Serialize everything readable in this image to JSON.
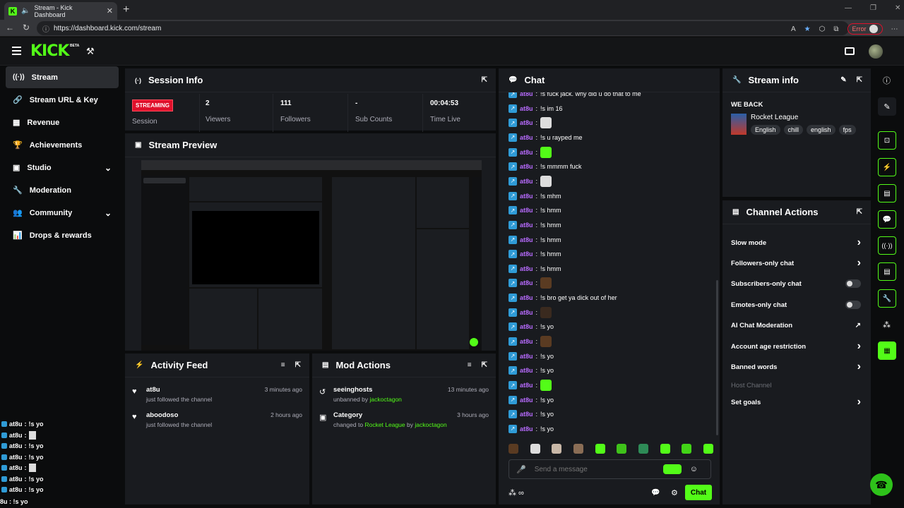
{
  "browser": {
    "tab_title": "Stream - Kick Dashboard",
    "url": "https://dashboard.kick.com/stream",
    "error_label": "Error"
  },
  "app": {
    "logo": "KICK",
    "logo_badge": "BETA"
  },
  "sidebar": {
    "items": [
      {
        "label": "Stream",
        "icon": "broadcast-icon"
      },
      {
        "label": "Stream URL & Key",
        "icon": "link-icon"
      },
      {
        "label": "Revenue",
        "icon": "revenue-icon"
      },
      {
        "label": "Achievements",
        "icon": "trophy-icon"
      },
      {
        "label": "Studio",
        "icon": "studio-icon"
      },
      {
        "label": "Moderation",
        "icon": "wrench-icon"
      },
      {
        "label": "Community",
        "icon": "community-icon"
      },
      {
        "label": "Drops & rewards",
        "icon": "drops-icon"
      }
    ]
  },
  "session": {
    "title": "Session Info",
    "status": "STREAMING",
    "stats": [
      {
        "value": "",
        "label": "Session"
      },
      {
        "value": "2",
        "label": "Viewers"
      },
      {
        "value": "111",
        "label": "Followers"
      },
      {
        "value": "-",
        "label": "Sub Counts"
      },
      {
        "value": "00:04:53",
        "label": "Time Live"
      }
    ]
  },
  "preview": {
    "title": "Stream Preview"
  },
  "activity": {
    "title": "Activity Feed",
    "items": [
      {
        "name": "at8u",
        "sub": "just followed the channel",
        "time": "3 minutes ago"
      },
      {
        "name": "aboodoso",
        "sub": "just followed the channel",
        "time": "2 hours ago"
      }
    ]
  },
  "mod": {
    "title": "Mod Actions",
    "items": [
      {
        "name": "seeinghosts",
        "sub_pre": "unbanned by",
        "actor": "jackoctagon",
        "time": "13 minutes ago"
      },
      {
        "name": "Category",
        "sub_pre": "changed to",
        "target": "Rocket League",
        "by": "by",
        "actor": "jackoctagon",
        "time": "3 hours ago"
      }
    ]
  },
  "chat": {
    "title": "Chat",
    "user": "at8u",
    "messages": [
      "!s fuck jack. why did u do that to me",
      "!s im 16",
      "",
      "!s u rayped me",
      "",
      "!s mmmm fuck",
      "",
      "!s mhm",
      "!s hmm",
      "!s hmm",
      "!s hmm",
      "!s hmm",
      "!s hmm",
      "",
      "!s bro get ya dick out of her",
      "",
      "!s yo",
      "",
      "!s yo",
      "!s yo",
      "",
      "!s yo",
      "!s yo",
      "!s yo"
    ],
    "input_placeholder": "Send a message",
    "send_label": "Chat"
  },
  "stream_info": {
    "title": "Stream info",
    "stream_title": "WE BACK",
    "category": "Rocket League",
    "tags": [
      "English",
      "chill",
      "english",
      "fps"
    ]
  },
  "channel_actions": {
    "title": "Channel Actions",
    "items": [
      {
        "label": "Slow mode",
        "control": "chevron"
      },
      {
        "label": "Followers-only chat",
        "control": "chevron"
      },
      {
        "label": "Subscribers-only chat",
        "control": "toggle"
      },
      {
        "label": "Emotes-only chat",
        "control": "toggle"
      },
      {
        "label": "AI Chat Moderation",
        "control": "external"
      },
      {
        "label": "Account age restriction",
        "control": "chevron"
      },
      {
        "label": "Banned words",
        "control": "chevron"
      },
      {
        "label": "Host Channel",
        "control": "none"
      },
      {
        "label": "Set goals",
        "control": "chevron"
      }
    ]
  },
  "overlay_chat": {
    "user": "at8u",
    "lines": [
      "!s yo",
      "",
      "!s yo",
      "!s yo",
      "",
      "!s yo",
      "!s yo"
    ],
    "last_line": "8u : !s yo"
  },
  "colors": {
    "accent": "#53fc18",
    "panel": "#191b1f",
    "username": "#b86bff",
    "streaming": "#e0102b"
  }
}
